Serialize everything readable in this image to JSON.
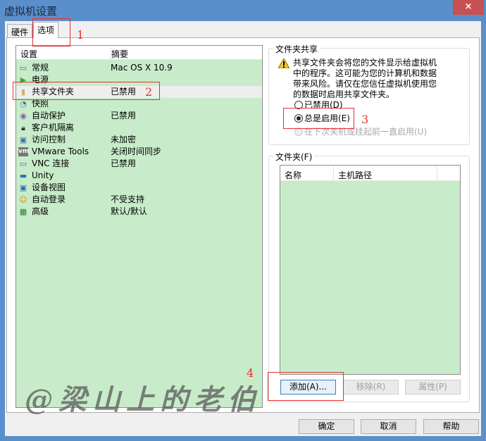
{
  "window": {
    "title": "虚拟机设置",
    "close": "×"
  },
  "tabs": [
    {
      "label": "硬件"
    },
    {
      "label": "选项",
      "active": true
    }
  ],
  "settings_list": {
    "headers": [
      "设置",
      "摘要"
    ],
    "rows": [
      {
        "icon": "monitor-icon",
        "name": "常规",
        "value": "Mac OS X 10.9"
      },
      {
        "icon": "power-play-icon",
        "name": "电源",
        "value": ""
      },
      {
        "icon": "shared-folder-icon",
        "name": "共享文件夹",
        "value": "已禁用",
        "selected": true
      },
      {
        "icon": "snapshot-icon",
        "name": "快照",
        "value": ""
      },
      {
        "icon": "autoprotect-icon",
        "name": "自动保护",
        "value": "已禁用"
      },
      {
        "icon": "lock-icon",
        "name": "客户机隔离",
        "value": ""
      },
      {
        "icon": "access-control-icon",
        "name": "访问控制",
        "value": "未加密"
      },
      {
        "icon": "vm-icon",
        "name": "VMware Tools",
        "value": "关闭时间同步"
      },
      {
        "icon": "vnc-icon",
        "name": "VNC 连接",
        "value": "已禁用"
      },
      {
        "icon": "unity-icon",
        "name": "Unity",
        "value": ""
      },
      {
        "icon": "device-view-icon",
        "name": "设备视图",
        "value": ""
      },
      {
        "icon": "autologin-icon",
        "name": "自动登录",
        "value": "不受支持"
      },
      {
        "icon": "advanced-icon",
        "name": "高级",
        "value": "默认/默认"
      }
    ]
  },
  "folder_sharing": {
    "label": "文件夹共享",
    "warning": "共享文件夹会将您的文件显示给虚拟机中的程序。这可能为您的计算机和数据带来风险。请仅在您信任虚拟机使用您的数据时启用共享文件夹。",
    "options": [
      {
        "label": "已禁用(D)",
        "checked": false,
        "enabled": true
      },
      {
        "label": "总是启用(E)",
        "checked": true,
        "enabled": true
      },
      {
        "label": "在下次关机或挂起前一直启用(U)",
        "checked": false,
        "enabled": false
      }
    ]
  },
  "folders": {
    "label": "文件夹(F)",
    "headers": [
      "名称",
      "主机路径"
    ],
    "buttons": {
      "add": "添加(A)...",
      "remove": "移除(R)",
      "properties": "属性(P)"
    }
  },
  "footer": {
    "ok": "确定",
    "cancel": "取消",
    "help": "帮助"
  },
  "annotations": [
    "1",
    "2",
    "3",
    "4"
  ],
  "watermark": "@梁山上的老伯",
  "colors": {
    "titlebar": "#5a8fcb",
    "list_bg": "#c8ecc9",
    "annotation": "#e53030",
    "close": "#c75050"
  }
}
